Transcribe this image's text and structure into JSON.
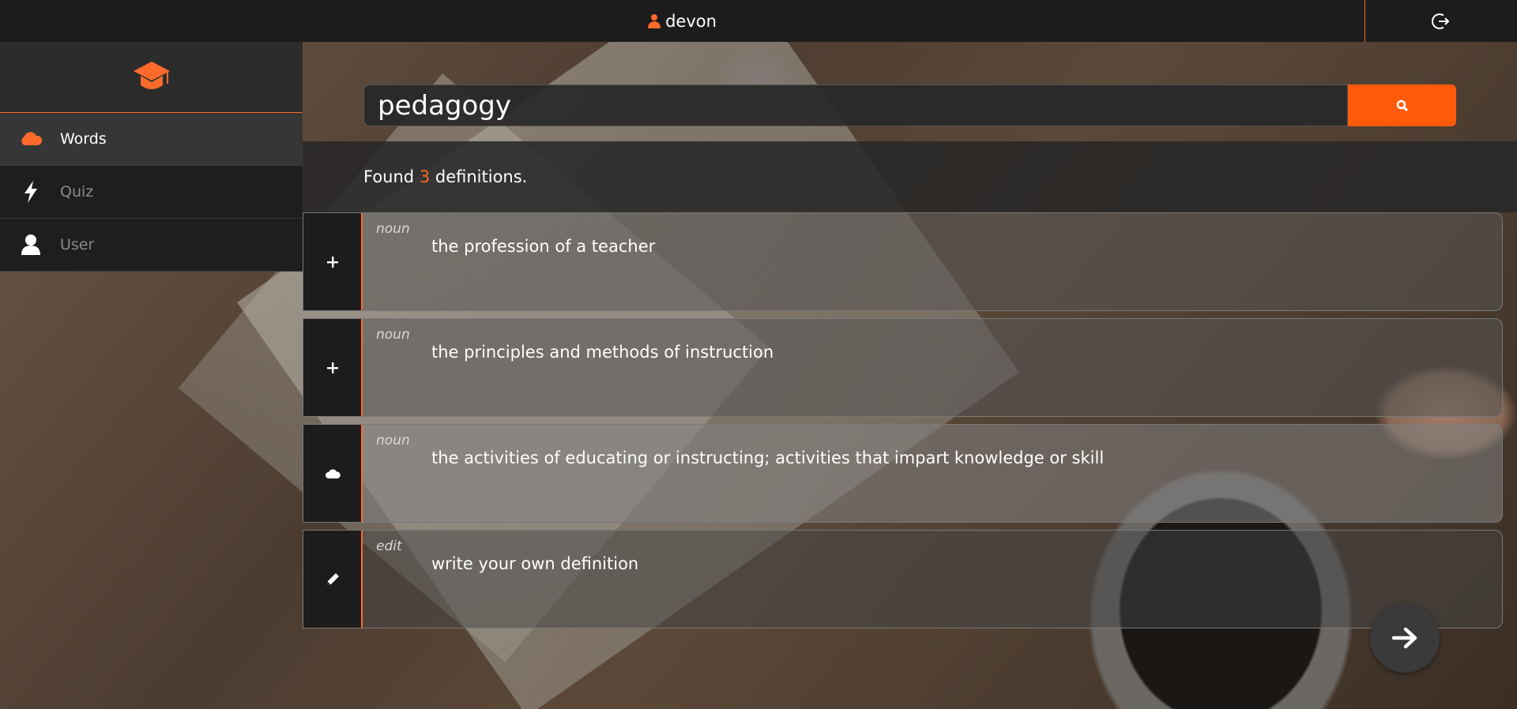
{
  "header": {
    "username": "devon"
  },
  "sidebar": {
    "items": [
      {
        "label": "Words",
        "icon": "cloud-icon",
        "active": true
      },
      {
        "label": "Quiz",
        "icon": "lightning-icon",
        "active": false
      },
      {
        "label": "User",
        "icon": "user-icon",
        "active": false
      }
    ]
  },
  "search": {
    "value": "pedagogy"
  },
  "results": {
    "prefix": "Found",
    "count": "3",
    "suffix": "definitions.",
    "definitions": [
      {
        "pos": "noun",
        "text": "the profession of a teacher",
        "action_icon": "plus-icon"
      },
      {
        "pos": "noun",
        "text": "the principles and methods of instruction",
        "action_icon": "plus-icon"
      },
      {
        "pos": "noun",
        "text": "the activities of educating or instructing; activities that impart knowledge or skill",
        "action_icon": "cloud-icon"
      },
      {
        "pos": "edit",
        "text": "write your own definition",
        "action_icon": "pencil-icon"
      }
    ]
  },
  "colors": {
    "accent": "#ff6a2a",
    "button": "#ff5a0a",
    "bar": "#1c1c1c"
  }
}
